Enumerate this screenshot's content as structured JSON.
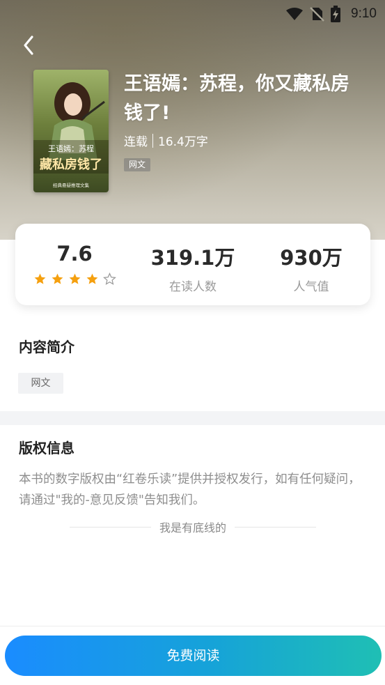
{
  "status_bar": {
    "time": "9:10"
  },
  "book": {
    "title": "王语嫣：苏程，你又藏私房钱了!",
    "status": "连载",
    "word_count": "16.4万字",
    "category_tag": "网文",
    "cover": {
      "title_text": "王语嫣：苏程",
      "subtitle_text": "藏私房钱了",
      "footer_text": "经典悬疑推理文集"
    }
  },
  "stats": {
    "rating": {
      "value": "7.6",
      "stars": 4,
      "max_stars": 5
    },
    "readers": {
      "value": "319.1万",
      "label": "在读人数"
    },
    "popularity": {
      "value": "930万",
      "label": "人气值"
    }
  },
  "intro": {
    "title": "内容简介",
    "tag": "网文"
  },
  "copyright": {
    "title": "版权信息",
    "text": "本书的数字版权由“红卷乐读”提供并授权发行，如有任何疑问，请通过\"我的-意见反馈\"告知我们。"
  },
  "bottom_line": "我是有底线的",
  "read_button": "免费阅读",
  "colors": {
    "star": "#f5a00f",
    "button_start": "#1a8cff",
    "button_end": "#1fbfb4"
  }
}
